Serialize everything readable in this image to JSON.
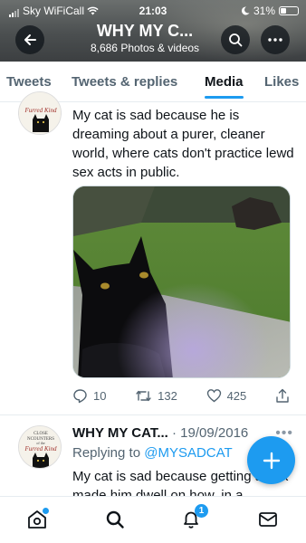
{
  "status_bar": {
    "carrier": "Sky WiFiCall",
    "time": "21:03",
    "battery": "31%"
  },
  "header": {
    "title": "WHY MY C...",
    "subtitle": "8,686 Photos & videos"
  },
  "tabs": [
    {
      "label": "Tweets",
      "active": false
    },
    {
      "label": "Tweets & replies",
      "active": false
    },
    {
      "label": "Media",
      "active": true
    },
    {
      "label": "Likes",
      "active": false
    }
  ],
  "avatar_text": {
    "line1": "CLOSE",
    "line2": "NCOUNTERS",
    "line3": "of the",
    "line4": "Furred Kind"
  },
  "tweet1": {
    "text": "My cat is sad because he is dreaming about a purer, cleaner world, where cats don't practice lewd sex acts in public.",
    "replies": "10",
    "retweets": "132",
    "likes": "425"
  },
  "tweet2": {
    "name": "WHY MY CAT...",
    "date": "· 19/09/2016",
    "replying_prefix": "Replying to ",
    "replying_handle": "@MYSADCAT",
    "text": "My cat is sad because getting a box made him dwell on how, in a"
  },
  "nav": {
    "notification_count": "1"
  },
  "colors": {
    "accent": "#1d9bf0",
    "text": "#0f1419",
    "muted": "#536471"
  }
}
